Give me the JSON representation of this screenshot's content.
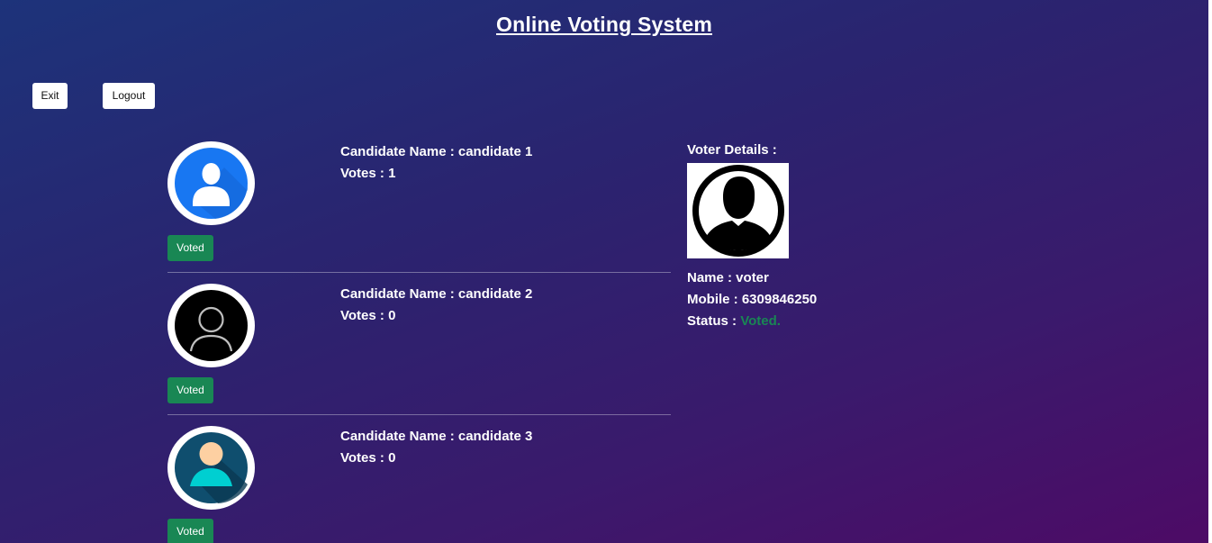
{
  "page": {
    "title": "Online Voting System"
  },
  "actions": {
    "exit_label": "Exit",
    "logout_label": "Logout"
  },
  "candidates": [
    {
      "name_label": "Candidate Name : candidate 1",
      "votes_label": "Votes : 1",
      "button_label": "Voted",
      "avatar_icon": "user-blue-circle-icon"
    },
    {
      "name_label": "Candidate Name : candidate 2",
      "votes_label": "Votes : 0",
      "button_label": "Voted",
      "avatar_icon": "user-outline-black-icon"
    },
    {
      "name_label": "Candidate Name : candidate 3",
      "votes_label": "Votes : 0",
      "button_label": "Voted",
      "avatar_icon": "user-teal-avatar-icon"
    }
  ],
  "voter": {
    "heading": "Voter Details :",
    "name_label": "Name : voter",
    "mobile_label": "Mobile : 6309846250",
    "status_prefix": "Status : ",
    "status_value": "Voted.",
    "photo_icon": "user-silhouette-icon"
  },
  "colors": {
    "success": "#198754",
    "gradient_start": "#1d337a",
    "gradient_end": "#4d0b66"
  }
}
